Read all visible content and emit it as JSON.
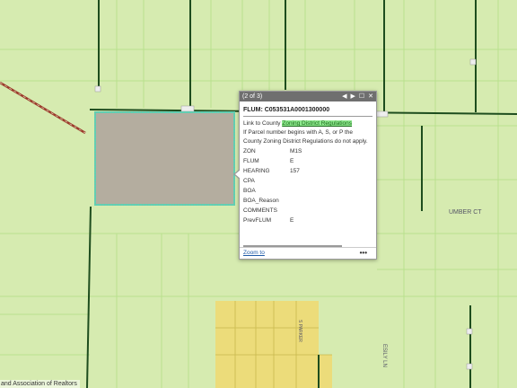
{
  "colors": {
    "map_background": "#d6ebb0",
    "parcel_lines": "#b9e08e",
    "dark_road": "#1e4d1e",
    "highway": "#9b3a2a",
    "selected_parcel_fill": "#b4ad9f",
    "selected_parcel_outline": "#5dd1b5",
    "yellow_zone": "#ecdc7a",
    "popup_header": "#6f6f6f",
    "link_highlight": "#8ee88e"
  },
  "map": {
    "street_labels": {
      "umber_ct": "UMBER CT",
      "lesily_ln": "ESILY LN",
      "vertical_street": "S PARKER"
    },
    "attribution": "and Association of Realtors"
  },
  "popup": {
    "counter": "(2 of 3)",
    "icons": {
      "prev": "prev-arrow-icon",
      "next": "next-arrow-icon",
      "maximize": "maximize-icon",
      "close": "close-icon"
    },
    "prev_glyph": "◀",
    "next_glyph": "▶",
    "maximize_glyph": "☐",
    "close_glyph": "✕",
    "title": "FLUM: C053531A0001300000",
    "link_prefix": "Link to County ",
    "link_text": "Zoning District Regulations",
    "note": "If Parcel number begins with A, S, or P the County Zoning District Regulations do not apply.",
    "attributes": [
      {
        "key": "ZON",
        "value": "M1S"
      },
      {
        "key": "FLUM",
        "value": "E"
      },
      {
        "key": "HEARING",
        "value": "157"
      },
      {
        "key": "CPA",
        "value": ""
      },
      {
        "key": "BOA",
        "value": ""
      },
      {
        "key": "BOA_Reason",
        "value": ""
      },
      {
        "key": "COMMENTS",
        "value": ""
      },
      {
        "key": "PrevFLUM",
        "value": "E"
      }
    ],
    "zoom_to": "Zoom to",
    "more": "•••"
  }
}
